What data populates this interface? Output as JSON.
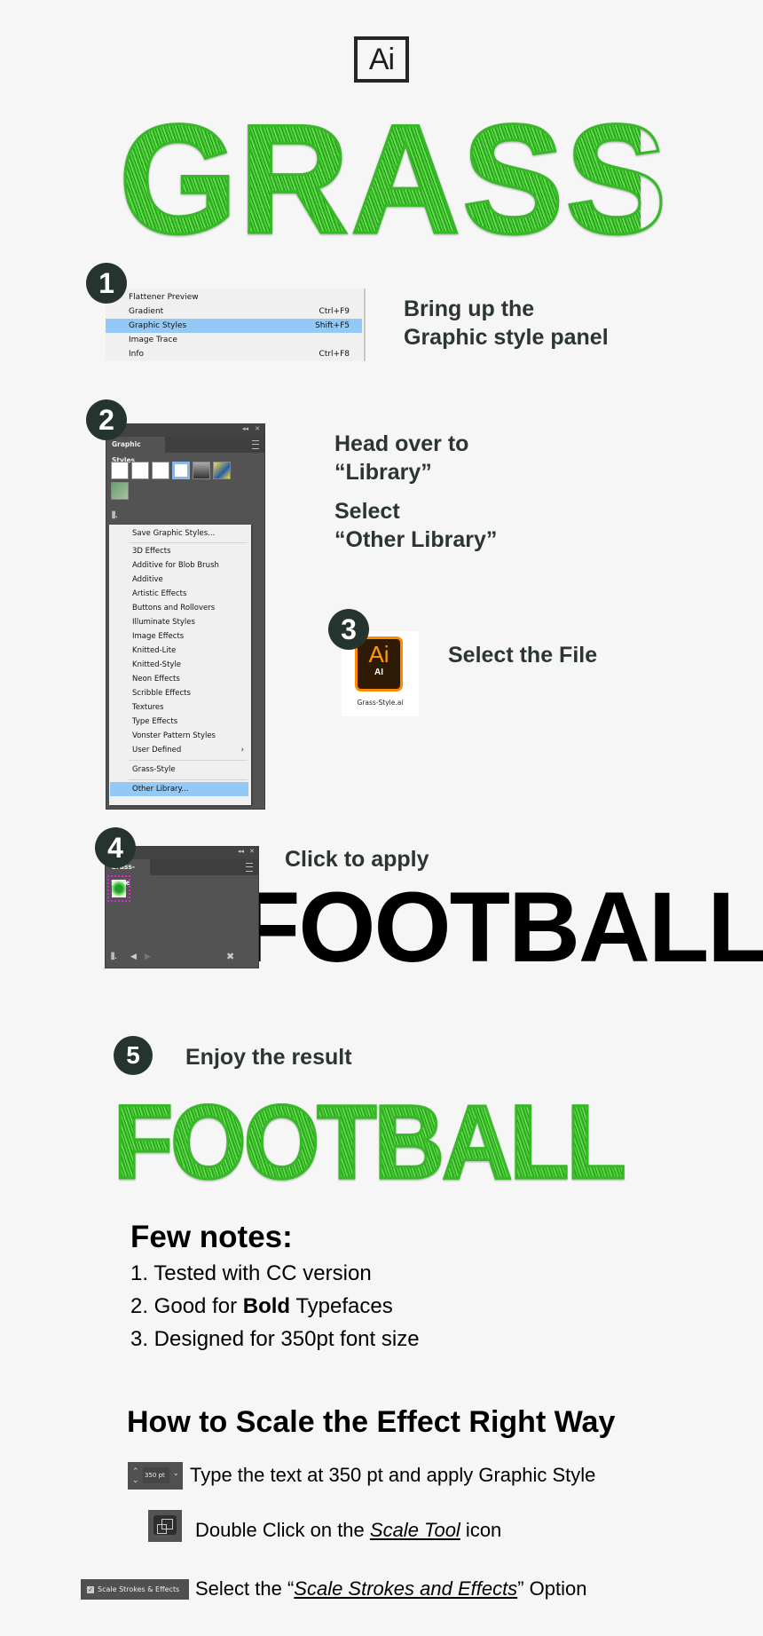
{
  "header": {
    "logo_text": "Ai",
    "title": "GRASS"
  },
  "step1": {
    "number": "1",
    "menu_items": [
      {
        "label": "Flattener Preview",
        "shortcut": ""
      },
      {
        "label": "Gradient",
        "shortcut": "Ctrl+F9"
      },
      {
        "label": "Graphic Styles",
        "shortcut": "Shift+F5",
        "selected": true
      },
      {
        "label": "Image Trace",
        "shortcut": ""
      },
      {
        "label": "Info",
        "shortcut": "Ctrl+F8"
      }
    ],
    "instruction_line1": "Bring up the",
    "instruction_line2": "Graphic style panel"
  },
  "step2": {
    "number": "2",
    "panel_title": "Graphic Styles",
    "menu_items": [
      "Save Graphic Styles...",
      "3D Effects",
      "Additive for Blob Brush",
      "Additive",
      "Artistic Effects",
      "Buttons and Rollovers",
      "Illuminate Styles",
      "Image Effects",
      "Knitted-Lite",
      "Knitted-Style",
      "Neon Effects",
      "Scribble Effects",
      "Textures",
      "Type Effects",
      "Vonster Pattern Styles",
      "User Defined",
      "Grass-Style",
      "Other Library..."
    ],
    "submenu_arrow": "›",
    "instruction_a_line1": "Head over to",
    "instruction_a_line2": "“Library”",
    "instruction_b_line1": "Select",
    "instruction_b_line2": "“Other Library”"
  },
  "step3": {
    "number": "3",
    "file_icon_text": "Ai",
    "file_icon_sub": "AI",
    "file_name": "Grass-Style.ai",
    "instruction": "Select the File"
  },
  "step4": {
    "number": "4",
    "panel_title": "Grass-Style",
    "instruction": "Click to apply",
    "sample_text": "FOOTBALL"
  },
  "step5": {
    "number": "5",
    "instruction": "Enjoy the result",
    "result_text": "FOOTBALL"
  },
  "notes": {
    "title": "Few notes:",
    "items": [
      {
        "prefix": "1. Tested with CC version",
        "bold": "",
        "suffix": ""
      },
      {
        "prefix": "2. Good for ",
        "bold": "Bold",
        "suffix": " Typefaces"
      },
      {
        "prefix": "3. Designed for 350pt font size",
        "bold": "",
        "suffix": ""
      }
    ]
  },
  "scaling": {
    "title": "How to Scale the Effect Right Way",
    "font_size_value": "350 pt",
    "step_a": "Type the text at 350 pt and apply Graphic Style",
    "step_b_prefix": "Double Click on the ",
    "step_b_link": "Scale Tool",
    "step_b_suffix": " icon",
    "checkbox_label": "Scale Strokes & Effects",
    "step_c_prefix": "Select the “",
    "step_c_link": "Scale Strokes and Effects",
    "step_c_suffix": "” Option"
  },
  "colors": {
    "badge": "#263430",
    "heading": "#2b3531",
    "grass": "#3bbf2a",
    "menu_highlight": "#93c9f6",
    "panel_bg": "#535353",
    "highlight_magenta": "#e81ee0",
    "ai_orange": "#ff8a00"
  }
}
